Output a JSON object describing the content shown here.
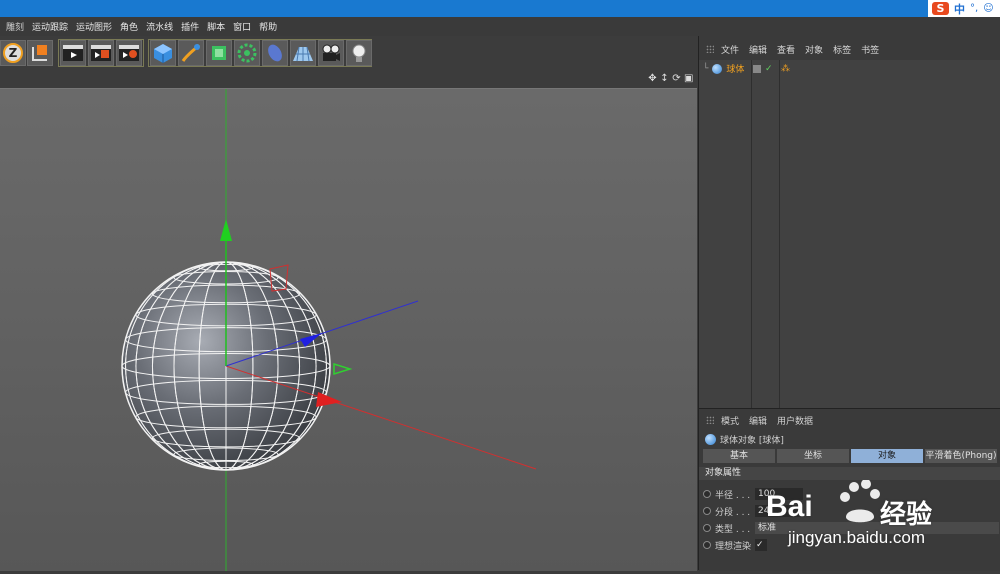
{
  "ime": {
    "logo": "S",
    "lang": "中",
    "symbols": "°,",
    "emoji": "☺"
  },
  "menu": [
    "雕刻",
    "运动跟踪",
    "运动图形",
    "角色",
    "流水线",
    "插件",
    "脚本",
    "窗口",
    "帮助"
  ],
  "object_manager": {
    "menu": [
      "文件",
      "编辑",
      "查看",
      "对象",
      "标签",
      "书签"
    ],
    "objects": [
      {
        "name": "球体"
      }
    ]
  },
  "attribute_manager": {
    "menu": [
      "模式",
      "编辑",
      "用户数据"
    ],
    "object_title": "球体对象 [球体]",
    "tabs": [
      "基本",
      "坐标",
      "对象",
      "平滑着色(Phong)"
    ],
    "active_tab": "对象",
    "section": "对象属性",
    "props": [
      {
        "label": "半径 . . .",
        "value": "100"
      },
      {
        "label": "分段 . . .",
        "value": "24"
      },
      {
        "label": "类型 . . .",
        "value": "标准"
      },
      {
        "label": "理想渲染",
        "value": "✓"
      }
    ]
  },
  "watermark": {
    "brand": "Bai",
    "brand2": "经验",
    "url": "jingyan.baidu.com"
  },
  "colors": {
    "titlebar": "#1979d0",
    "accent_object": "#f0a020",
    "tab_active": "#8fb0d8"
  }
}
